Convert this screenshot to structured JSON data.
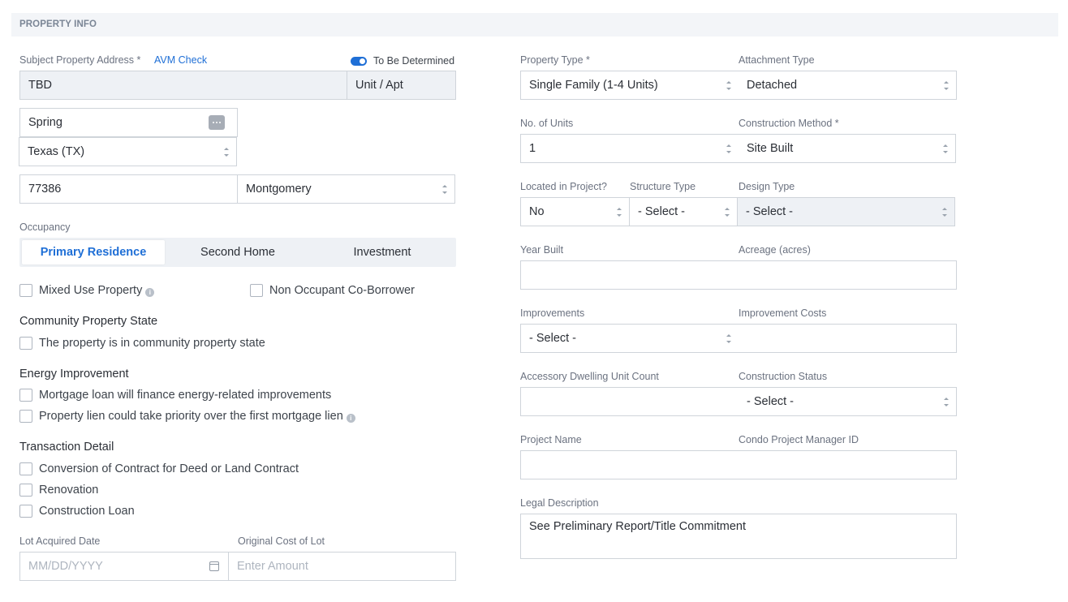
{
  "section": {
    "title": "PROPERTY INFO"
  },
  "address": {
    "label": "Subject Property Address *",
    "avm_link": "AVM Check",
    "tbd_label": "To Be Determined",
    "tbd_on": true,
    "street": "TBD",
    "unit_value": "Unit / Apt",
    "city": "Spring",
    "state": "Texas (TX)",
    "zip": "77386",
    "county": "Montgomery"
  },
  "occupancy": {
    "label": "Occupancy",
    "options": [
      "Primary Residence",
      "Second Home",
      "Investment"
    ],
    "selected": "Primary Residence"
  },
  "checks": {
    "mixed_use": "Mixed Use Property",
    "non_occupant": "Non Occupant Co-Borrower"
  },
  "community": {
    "title": "Community Property State",
    "item": "The property is in community property state"
  },
  "energy": {
    "title": "Energy Improvement",
    "items": [
      "Mortgage loan will finance energy-related improvements",
      "Property lien could take priority over the first mortgage lien"
    ]
  },
  "transaction": {
    "title": "Transaction Detail",
    "items": [
      "Conversion of Contract for Deed or Land Contract",
      "Renovation",
      "Construction Loan"
    ]
  },
  "lot": {
    "date_label": "Lot Acquired Date",
    "date_placeholder": "MM/DD/YYYY",
    "cost_label": "Original Cost of Lot",
    "cost_placeholder": "Enter Amount"
  },
  "right": {
    "property_type": {
      "label": "Property Type *",
      "value": "Single Family (1-4 Units)"
    },
    "attachment_type": {
      "label": "Attachment Type",
      "value": "Detached"
    },
    "units": {
      "label": "No. of Units",
      "value": "1"
    },
    "construction_method": {
      "label": "Construction Method *",
      "value": "Site Built"
    },
    "located_in_project": {
      "label": "Located in Project?",
      "value": "No"
    },
    "structure_type": {
      "label": "Structure Type",
      "value": "- Select -"
    },
    "design_type": {
      "label": "Design Type",
      "value": "- Select -"
    },
    "year_built": {
      "label": "Year Built",
      "value": ""
    },
    "acreage": {
      "label": "Acreage (acres)",
      "value": ""
    },
    "improvements": {
      "label": "Improvements",
      "value": "- Select -"
    },
    "improvement_costs": {
      "label": "Improvement Costs",
      "value": ""
    },
    "adu_count": {
      "label": "Accessory Dwelling Unit Count",
      "value": ""
    },
    "construction_status": {
      "label": "Construction Status",
      "value": "- Select -"
    },
    "project_name": {
      "label": "Project Name",
      "value": ""
    },
    "condo_id": {
      "label": "Condo Project Manager ID",
      "value": ""
    },
    "legal_description": {
      "label": "Legal Description",
      "value": "See Preliminary Report/Title Commitment"
    }
  },
  "colors": {
    "accent": "#1f6fd6",
    "header_bg": "#f3f5f8",
    "readonly_bg": "#eef1f5"
  }
}
